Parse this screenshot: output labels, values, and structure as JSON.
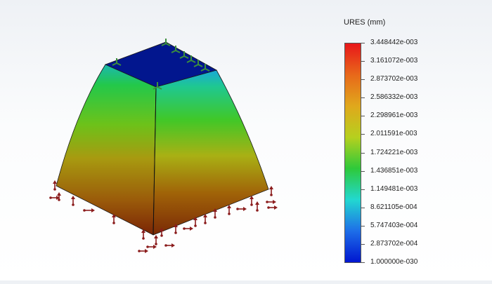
{
  "legend": {
    "title": "URES (mm)",
    "labels": [
      "3.448442e-003",
      "3.161072e-003",
      "2.873702e-003",
      "2.586332e-003",
      "2.298961e-003",
      "2.011591e-003",
      "1.724221e-003",
      "1.436851e-003",
      "1.149481e-003",
      "8.621105e-004",
      "5.747403e-004",
      "2.873702e-004",
      "1.000000e-030"
    ],
    "gradient": [
      "#e8161a",
      "#e8681a",
      "#e0a81c",
      "#b6d01e",
      "#2ec93a",
      "#22d8d0",
      "#1e6ee8",
      "#0016d0"
    ]
  },
  "model": {
    "top_color": "#02168e",
    "fixture_color": "#3c8f3c",
    "load_color": "#8b1c1c"
  }
}
